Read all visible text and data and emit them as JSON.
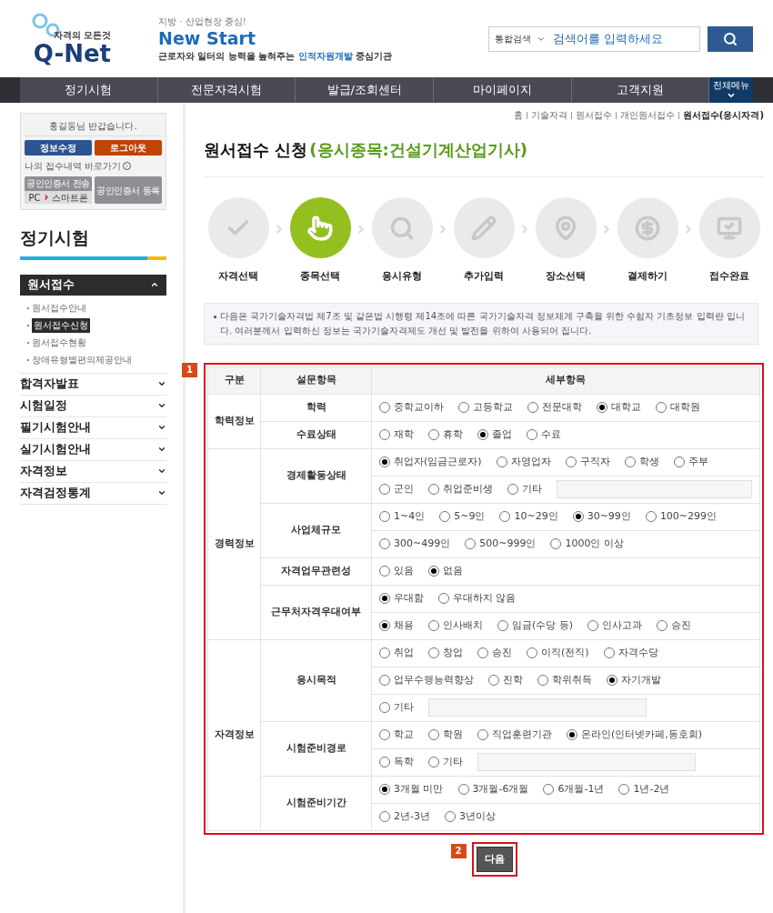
{
  "header": {
    "logo_tagline": "자격의 모든것",
    "logo_text": "Q-Net",
    "slogan_top": "지방 · 산업현장 중심!",
    "slogan_title": "New Start",
    "slogan_bottom": "근로자와 일터의 능력을 높혀주는 **인적자원개발** 중심기관",
    "search_scope": "통합검색",
    "search_placeholder": "검색어를 입력하세요"
  },
  "nav": {
    "items": [
      "정기시험",
      "전문자격시험",
      "발급/조회센터",
      "마이페이지",
      "고객지원"
    ],
    "all_menu": "전체메뉴"
  },
  "sidebar": {
    "greeting": "홍길동님 반갑습니다.",
    "edit_button": "정보수정",
    "logout_button": "로그아웃",
    "history_link": "나의 접수내역 바로가기",
    "cert_send_button": "공인인증서 전송",
    "cert_send_from": "PC",
    "cert_send_to": "스마트폰",
    "cert_register_button": "공인인증서 등록",
    "section_title": "정기시험",
    "menu": [
      {
        "label": "원서접수",
        "expanded": true,
        "children": [
          {
            "label": "원서접수안내",
            "selected": false
          },
          {
            "label": "원서접수신청",
            "selected": true
          },
          {
            "label": "원서접수현황",
            "selected": false
          },
          {
            "label": "장애유형별편의제공안내",
            "selected": false
          }
        ]
      },
      {
        "label": "합격자발표",
        "expanded": false
      },
      {
        "label": "시험일정",
        "expanded": false
      },
      {
        "label": "필기시험안내",
        "expanded": false
      },
      {
        "label": "실기시험안내",
        "expanded": false
      },
      {
        "label": "자격정보",
        "expanded": false
      },
      {
        "label": "자격검정통계",
        "expanded": false
      }
    ]
  },
  "breadcrumb": [
    "홈",
    "기술자격",
    "원서접수",
    "개인원서접수",
    "원서접수(응시자격)"
  ],
  "page_title": "원서접수 신청",
  "page_subtitle": "(응시종목:건설기계산업기사)",
  "steps": [
    {
      "label": "자격선택",
      "selected": false
    },
    {
      "label": "종목선택",
      "selected": true
    },
    {
      "label": "응시유형",
      "selected": false
    },
    {
      "label": "추가입력",
      "selected": false
    },
    {
      "label": "장소선택",
      "selected": false
    },
    {
      "label": "결제하기",
      "selected": false
    },
    {
      "label": "접수완료",
      "selected": false
    }
  ],
  "notice": "다음은 국가기술자격법 제7조 및 같은법 시행령 제14조에 따른 국가기술자격 정보체계 구축을 위한 수험자 기초정보 입력란 입니다. 여러분께서 입력하신 정보는 국가기술자격제도 개선 및 발전을 위하여 사용되어 집니다.",
  "table_marker": "1",
  "table": {
    "columns": [
      "구분",
      "설문항목",
      "세부항목"
    ],
    "groups": [
      {
        "label": "학력정보",
        "questions": [
          {
            "label": "학력",
            "lines": [
              {
                "options": [
                  {
                    "kind": "radio",
                    "label": "중학교이하",
                    "selected": false
                  },
                  {
                    "kind": "radio",
                    "label": "고등학교",
                    "selected": false
                  },
                  {
                    "kind": "radio",
                    "label": "전문대학",
                    "selected": false
                  },
                  {
                    "kind": "radio",
                    "label": "대학교",
                    "selected": true
                  },
                  {
                    "kind": "radio",
                    "label": "대학원",
                    "selected": false
                  }
                ]
              }
            ]
          },
          {
            "label": "수료상태",
            "lines": [
              {
                "options": [
                  {
                    "kind": "radio",
                    "label": "재학",
                    "selected": false
                  },
                  {
                    "kind": "radio",
                    "label": "휴학",
                    "selected": false
                  },
                  {
                    "kind": "radio",
                    "label": "졸업",
                    "selected": true
                  },
                  {
                    "kind": "radio",
                    "label": "수료",
                    "selected": false
                  }
                ]
              }
            ]
          }
        ]
      },
      {
        "label": "경력정보",
        "questions": [
          {
            "label": "경제활동상태",
            "lines": [
              {
                "options": [
                  {
                    "kind": "radio",
                    "label": "취업자(임금근로자)",
                    "selected": true
                  },
                  {
                    "kind": "radio",
                    "label": "자영업자",
                    "selected": false
                  },
                  {
                    "kind": "radio",
                    "label": "구직자",
                    "selected": false
                  },
                  {
                    "kind": "radio",
                    "label": "학생",
                    "selected": false
                  },
                  {
                    "kind": "radio",
                    "label": "주부",
                    "selected": false
                  }
                ]
              },
              {
                "options": [
                  {
                    "kind": "radio",
                    "label": "군인",
                    "selected": false
                  },
                  {
                    "kind": "radio",
                    "label": "취업준비생",
                    "selected": false
                  },
                  {
                    "kind": "radio",
                    "label": "기타",
                    "selected": false
                  },
                  {
                    "kind": "field"
                  }
                ]
              }
            ]
          },
          {
            "label": "사업체규모",
            "lines": [
              {
                "options": [
                  {
                    "kind": "radio",
                    "label": "1~4인",
                    "selected": false
                  },
                  {
                    "kind": "radio",
                    "label": "5~9인",
                    "selected": false
                  },
                  {
                    "kind": "radio",
                    "label": "10~29인",
                    "selected": false
                  },
                  {
                    "kind": "radio",
                    "label": "30~99인",
                    "selected": true
                  },
                  {
                    "kind": "radio",
                    "label": "100~299인",
                    "selected": false
                  }
                ]
              },
              {
                "options": [
                  {
                    "kind": "radio",
                    "label": "300~499인",
                    "selected": false
                  },
                  {
                    "kind": "radio",
                    "label": "500~999인",
                    "selected": false
                  },
                  {
                    "kind": "radio",
                    "label": "1000인 이상",
                    "selected": false
                  }
                ]
              }
            ]
          },
          {
            "label": "자격업무관련성",
            "lines": [
              {
                "options": [
                  {
                    "kind": "radio",
                    "label": "있음",
                    "selected": false
                  },
                  {
                    "kind": "radio",
                    "label": "없음",
                    "selected": true
                  }
                ]
              }
            ]
          },
          {
            "label": "근무처자격우대여부",
            "lines": [
              {
                "options": [
                  {
                    "kind": "radio",
                    "label": "우대함",
                    "selected": true
                  },
                  {
                    "kind": "radio",
                    "label": "우대하지 않음",
                    "selected": false
                  }
                ]
              },
              {
                "options": [
                  {
                    "kind": "radio",
                    "label": "채용",
                    "selected": true
                  },
                  {
                    "kind": "radio",
                    "label": "인사배치",
                    "selected": false
                  },
                  {
                    "kind": "radio",
                    "label": "임금(수당 등)",
                    "selected": false
                  },
                  {
                    "kind": "radio",
                    "label": "인사고과",
                    "selected": false
                  },
                  {
                    "kind": "radio",
                    "label": "승진",
                    "selected": false
                  }
                ]
              }
            ]
          }
        ]
      },
      {
        "label": "자격정보",
        "questions": [
          {
            "label": "응시목적",
            "lines": [
              {
                "options": [
                  {
                    "kind": "radio",
                    "label": "취업",
                    "selected": false
                  },
                  {
                    "kind": "radio",
                    "label": "창업",
                    "selected": false
                  },
                  {
                    "kind": "radio",
                    "label": "승진",
                    "selected": false
                  },
                  {
                    "kind": "radio",
                    "label": "이직(전직)",
                    "selected": false
                  },
                  {
                    "kind": "radio",
                    "label": "자격수당",
                    "selected": false
                  }
                ]
              },
              {
                "options": [
                  {
                    "kind": "radio",
                    "label": "업무수행능력향상",
                    "selected": false
                  },
                  {
                    "kind": "radio",
                    "label": "진학",
                    "selected": false
                  },
                  {
                    "kind": "radio",
                    "label": "학위취득",
                    "selected": false
                  },
                  {
                    "kind": "radio",
                    "label": "자기개발",
                    "selected": true
                  }
                ]
              },
              {
                "options": [
                  {
                    "kind": "radio",
                    "label": "기타",
                    "selected": false
                  },
                  {
                    "kind": "field"
                  }
                ]
              }
            ]
          },
          {
            "label": "시험준비경로",
            "lines": [
              {
                "options": [
                  {
                    "kind": "radio",
                    "label": "학교",
                    "selected": false
                  },
                  {
                    "kind": "radio",
                    "label": "학원",
                    "selected": false
                  },
                  {
                    "kind": "radio",
                    "label": "직업훈련기관",
                    "selected": false
                  },
                  {
                    "kind": "radio",
                    "label": "온라인(인터넷카페,동호회)",
                    "selected": true
                  }
                ]
              },
              {
                "options": [
                  {
                    "kind": "radio",
                    "label": "독학",
                    "selected": false
                  },
                  {
                    "kind": "radio",
                    "label": "기타",
                    "selected": false
                  },
                  {
                    "kind": "field"
                  }
                ]
              }
            ]
          },
          {
            "label": "시험준비기간",
            "lines": [
              {
                "options": [
                  {
                    "kind": "radio",
                    "label": "3개월 미만",
                    "selected": true
                  },
                  {
                    "kind": "radio",
                    "label": "3개월-6개월",
                    "selected": false
                  },
                  {
                    "kind": "radio",
                    "label": "6개월-1년",
                    "selected": false
                  },
                  {
                    "kind": "radio",
                    "label": "1년-2년",
                    "selected": false
                  }
                ]
              },
              {
                "options": [
                  {
                    "kind": "radio",
                    "label": "2년-3년",
                    "selected": false
                  },
                  {
                    "kind": "radio",
                    "label": "3년이상",
                    "selected": false
                  }
                ]
              }
            ]
          }
        ]
      }
    ]
  },
  "button_marker": "2",
  "next_button": "다음"
}
